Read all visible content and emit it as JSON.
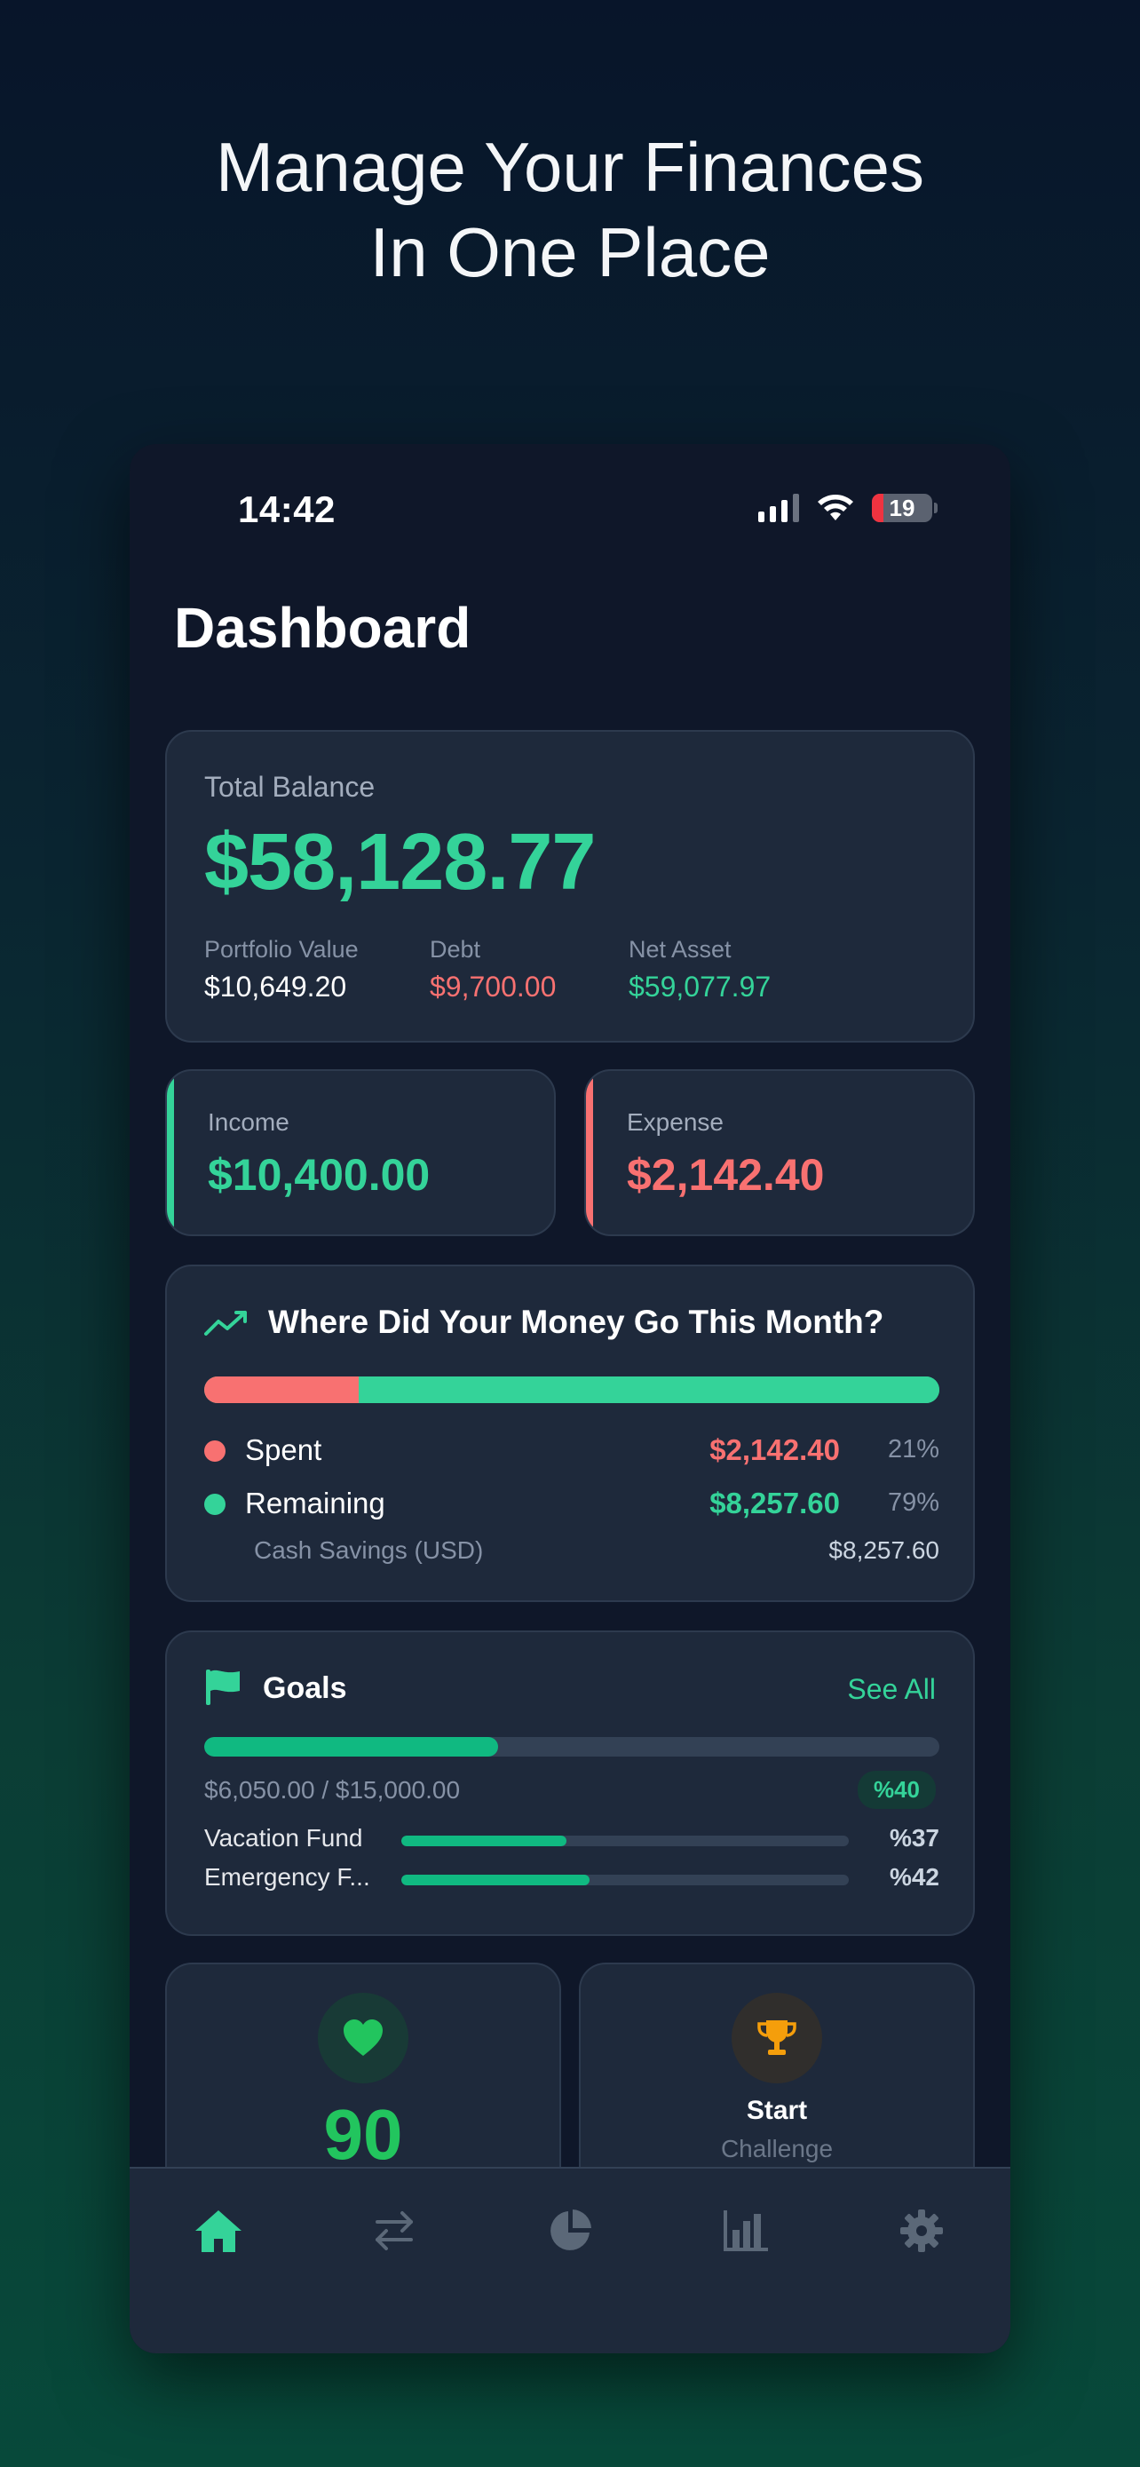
{
  "headline": {
    "line1": "Manage Your Finances",
    "line2": "In One Place"
  },
  "status_bar": {
    "time": "14:42",
    "battery": "19"
  },
  "page_title": "Dashboard",
  "balance": {
    "label": "Total Balance",
    "value": "$58,128.77",
    "portfolio_label": "Portfolio Value",
    "portfolio_value": "$10,649.20",
    "debt_label": "Debt",
    "debt_value": "$9,700.00",
    "net_label": "Net Asset",
    "net_value": "$59,077.97"
  },
  "income": {
    "label": "Income",
    "value": "$10,400.00"
  },
  "expense": {
    "label": "Expense",
    "value": "$2,142.40"
  },
  "spending": {
    "title": "Where Did Your Money Go This Month?",
    "spent_fraction": 0.21,
    "spent_label": "Spent",
    "spent_amount": "$2,142.40",
    "spent_pct": "21%",
    "remaining_label": "Remaining",
    "remaining_amount": "$8,257.60",
    "remaining_pct": "79%",
    "savings_label": "Cash Savings (USD)",
    "savings_amount": "$8,257.60"
  },
  "goals": {
    "title": "Goals",
    "see_all": "See All",
    "progress_fraction": 0.4,
    "amount": "$6,050.00 / $15,000.00",
    "badge": "%40",
    "items": [
      {
        "name": "Vacation Fund",
        "fraction": 0.37,
        "pct": "%37"
      },
      {
        "name": "Emergency F...",
        "fraction": 0.42,
        "pct": "%42"
      }
    ]
  },
  "health": {
    "score": "90",
    "icon": "heart-icon"
  },
  "challenge": {
    "label": "Start",
    "sub": "Challenge",
    "icon": "trophy-icon"
  },
  "tabs": [
    "home-icon",
    "transfer-icon",
    "pie-chart-icon",
    "bar-chart-icon",
    "settings-icon"
  ],
  "colors": {
    "accent_green": "#34d399",
    "accent_red": "#f87171",
    "card_bg": "#1e293b",
    "screen_bg": "#0f1729",
    "trophy": "#f59e0b"
  }
}
